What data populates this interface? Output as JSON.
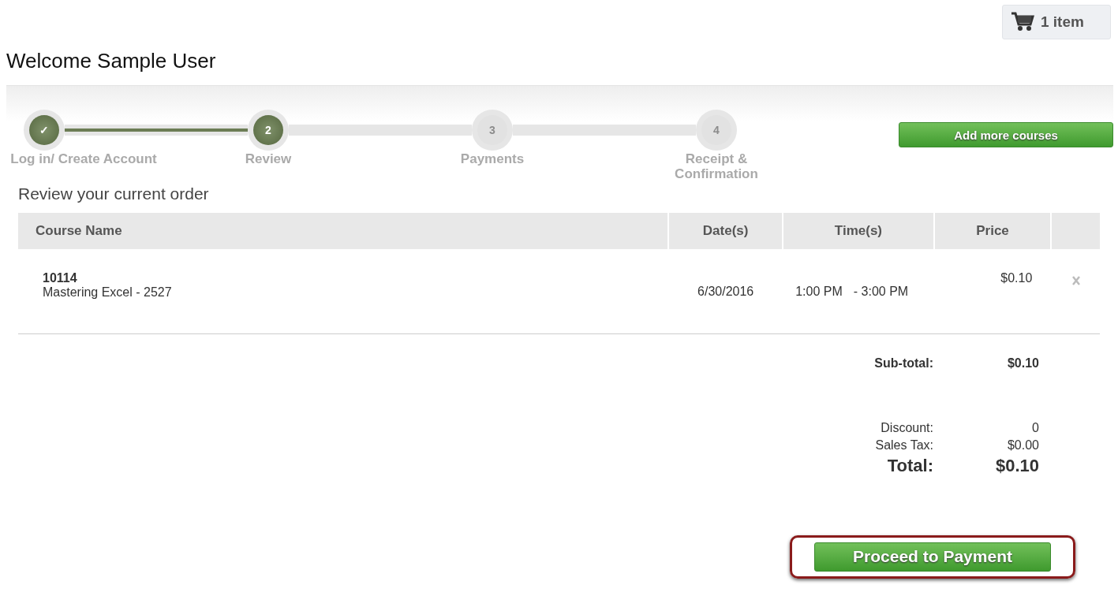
{
  "cart": {
    "label": "1 item"
  },
  "title": "Welcome Sample User",
  "steps": [
    {
      "marker": "✓",
      "label": "Log in/ Create Account",
      "reached": true
    },
    {
      "marker": "2",
      "label": "Review",
      "reached": true
    },
    {
      "marker": "3",
      "label": "Payments",
      "reached": false
    },
    {
      "marker": "4",
      "label": "Receipt & Confirmation",
      "reached": false
    }
  ],
  "add_button": "Add more courses",
  "heading": "Review your current order",
  "table": {
    "columns": [
      "Course Name",
      "Date(s)",
      "Time(s)",
      "Price"
    ],
    "rows": [
      {
        "code": "10114",
        "name": "Mastering Excel - 2527",
        "date": "6/30/2016",
        "start": "1:00 PM",
        "end": "- 3:00 PM",
        "price": "$0.10"
      }
    ]
  },
  "subtotal": {
    "label": "Sub-total:",
    "value": "$0.10"
  },
  "summary": [
    {
      "label": "Discount:",
      "value": "0",
      "kind": "normal"
    },
    {
      "label": "Sales Tax:",
      "value": "$0.00",
      "kind": "normal"
    },
    {
      "label": "Total:",
      "value": "$0.10",
      "kind": "total"
    }
  ],
  "proceed_button": {
    "label": "Proceed to Payment",
    "highlighted": true
  }
}
